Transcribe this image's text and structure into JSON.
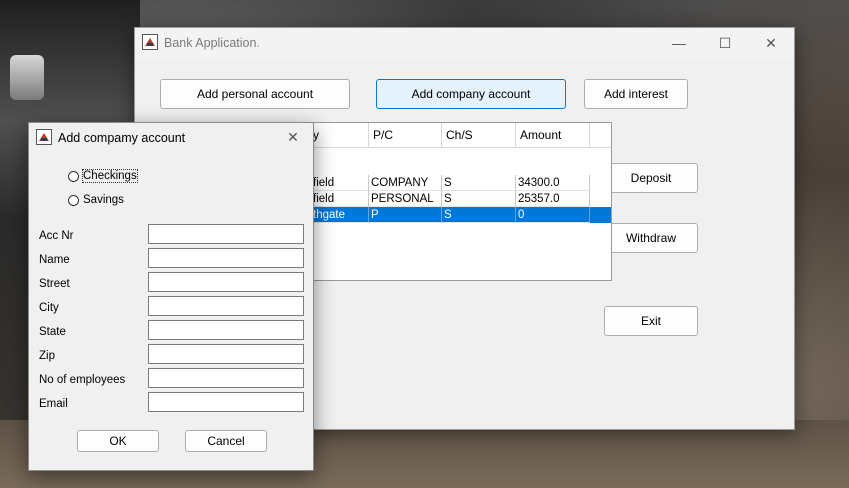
{
  "main_window": {
    "title": "Bank Application.",
    "controls": {
      "minimize": "—",
      "maximize": "☐",
      "close": "✕"
    },
    "buttons": {
      "add_personal": "Add personal account",
      "add_company": "Add company account",
      "add_interest": "Add interest",
      "deposit": "Deposit",
      "withdraw": "Withdraw",
      "exit": "Exit"
    },
    "table": {
      "columns": [
        "y",
        "P/C",
        "Ch/S",
        "Amount"
      ],
      "rows": [
        [
          "field",
          "COMPANY",
          "S",
          "34300.0"
        ],
        [
          "field",
          "PERSONAL",
          "S",
          "25357.0"
        ],
        [
          "thgate",
          "P",
          "S",
          "0"
        ]
      ],
      "selected_row": 2
    }
  },
  "dialog": {
    "title": "Add compamy account",
    "close": "✕",
    "radios": {
      "checkings": "Checkings",
      "savings": "Savings"
    },
    "fields": {
      "acc_nr": "Acc Nr",
      "name": "Name",
      "street": "Street",
      "city": "City",
      "state": "State",
      "zip": "Zip",
      "employees": "No of employees",
      "email": "Email"
    },
    "ok": "OK",
    "cancel": "Cancel"
  },
  "colors": {
    "accent": "#0078d7",
    "active_button": "#e5f1fb",
    "window_bg": "#f0f0f0"
  }
}
